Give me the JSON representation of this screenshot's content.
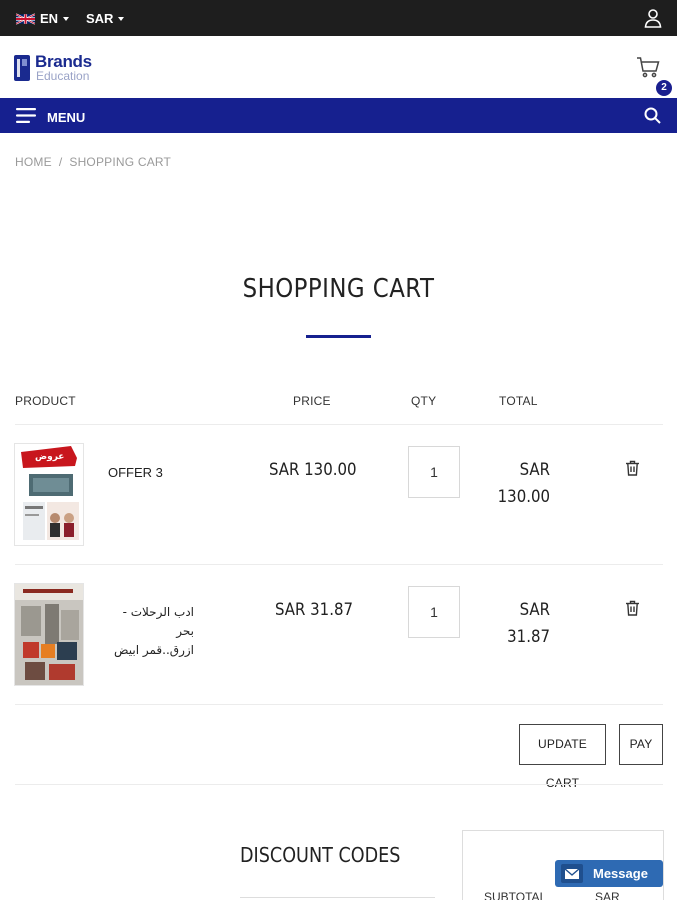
{
  "topbar": {
    "language": "EN",
    "currency": "SAR"
  },
  "header": {
    "brand": "Brands",
    "brand_sub": "Education",
    "cart_count": "2"
  },
  "nav": {
    "menu_label": "MENU"
  },
  "breadcrumb": {
    "home": "HOME",
    "separator": "/",
    "current": "SHOPPING CART"
  },
  "page": {
    "title": "SHOPPING CART"
  },
  "table": {
    "headers": {
      "product": "PRODUCT",
      "price": "PRICE",
      "qty": "QTY",
      "total": "TOTAL"
    },
    "items": [
      {
        "name": "OFFER 3",
        "price": "SAR 130.00",
        "qty": "1",
        "total_currency": "SAR",
        "total_amount": "130.00",
        "thumb_badge": "عروض"
      },
      {
        "name_line1": "ادب الرحلات - بحر",
        "name_line2": "ازرق..قمر ابيض",
        "price": "SAR 31.87",
        "qty": "1",
        "total_currency": "SAR",
        "total_amount": "31.87"
      }
    ]
  },
  "actions": {
    "update_cart": "UPDATE CART",
    "pay": "PAY"
  },
  "discount": {
    "title": "DISCOUNT CODES"
  },
  "summary": {
    "subtotal_label": "SUBTOTAL",
    "subtotal_value": "SAR"
  },
  "chat": {
    "label": "Message"
  },
  "colors": {
    "brand_blue": "#16208f",
    "topbar": "#1e1e1e",
    "chat_blue": "#2e6ab3"
  }
}
